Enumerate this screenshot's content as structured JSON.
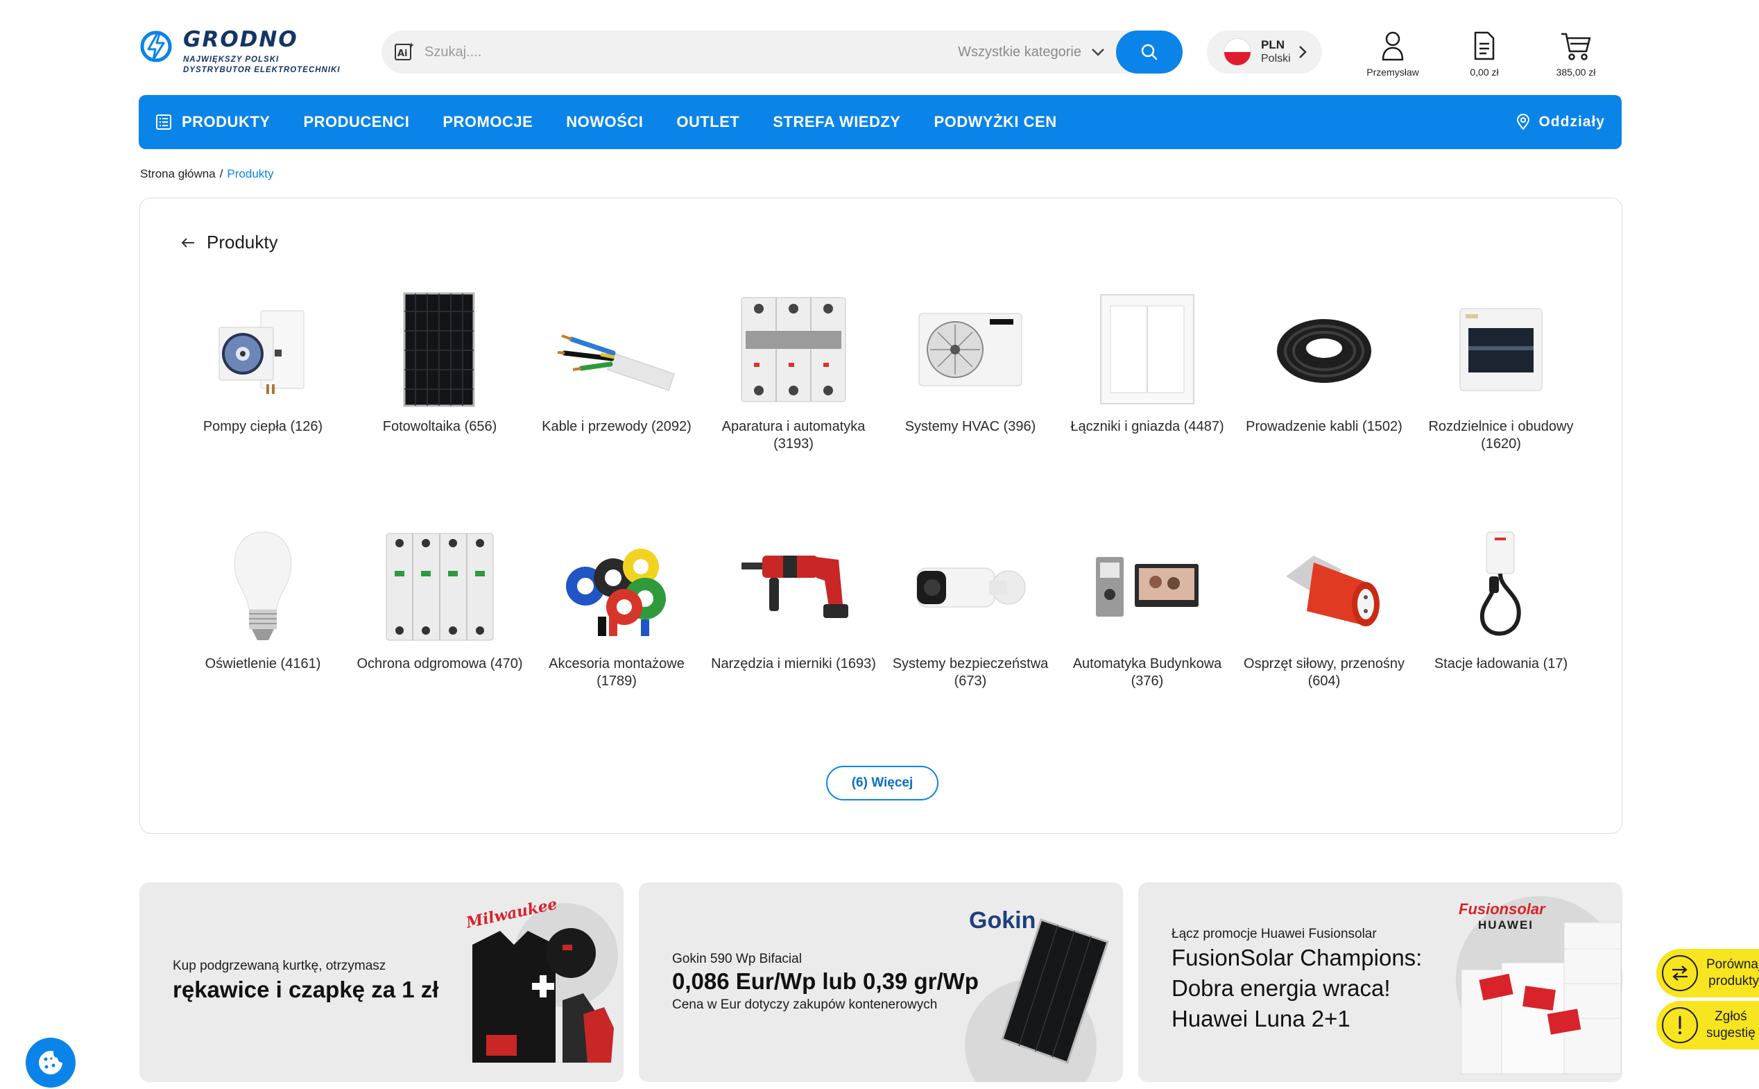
{
  "header": {
    "logo": {
      "title": "GRODNO",
      "subtitle_line1": "NAJWIĘKSZY POLSKI",
      "subtitle_line2": "DYSTRYBUTOR ELEKTROTECHNIKI"
    },
    "search": {
      "placeholder": "Szukaj....",
      "category": "Wszystkie kategorie"
    },
    "currency": {
      "code": "PLN",
      "language": "Polski"
    },
    "account": {
      "label": "Przemysław"
    },
    "documents": {
      "label": "0,00 zł"
    },
    "cart": {
      "label": "385,00 zł"
    }
  },
  "nav": {
    "items": [
      {
        "label": "PRODUKTY"
      },
      {
        "label": "PRODUCENCI"
      },
      {
        "label": "PROMOCJE"
      },
      {
        "label": "NOWOŚCI"
      },
      {
        "label": "OUTLET"
      },
      {
        "label": "STREFA WIEDZY"
      },
      {
        "label": "PODWYŻKI CEN"
      }
    ],
    "branches": "Oddziały"
  },
  "breadcrumb": {
    "home": "Strona główna",
    "separator": "/",
    "current": "Produkty"
  },
  "products": {
    "title": "Produkty",
    "categories": [
      {
        "label": "Pompy ciepła (126)",
        "icon": "heat-pump"
      },
      {
        "label": "Fotowoltaika (656)",
        "icon": "solar-panel"
      },
      {
        "label": "Kable i przewody (2092)",
        "icon": "cable"
      },
      {
        "label": "Aparatura i automatyka (3193)",
        "icon": "circuit-breaker"
      },
      {
        "label": "Systemy HVAC (396)",
        "icon": "ac-unit"
      },
      {
        "label": "Łączniki i gniazda (4487)",
        "icon": "wall-switch"
      },
      {
        "label": "Prowadzenie kabli (1502)",
        "icon": "conduit-coil"
      },
      {
        "label": "Rozdzielnice i obudowy (1620)",
        "icon": "distribution-box"
      },
      {
        "label": "Oświetlenie (4161)",
        "icon": "light-bulb"
      },
      {
        "label": "Ochrona odgromowa (470)",
        "icon": "surge-protector"
      },
      {
        "label": "Akcesoria montażowe (1789)",
        "icon": "insulating-tape"
      },
      {
        "label": "Narzędzia i mierniki (1693)",
        "icon": "hammer-drill"
      },
      {
        "label": "Systemy bezpieczeństwa (673)",
        "icon": "cctv-camera"
      },
      {
        "label": "Automatyka Budynkowa (376)",
        "icon": "intercom"
      },
      {
        "label": "Osprzęt siłowy, przenośny (604)",
        "icon": "industrial-plug"
      },
      {
        "label": "Stacje ładowania (17)",
        "icon": "ev-charger"
      }
    ],
    "more_button": "(6) Więcej"
  },
  "promos": [
    {
      "small": "Kup podgrzewaną kurtkę, otrzymasz",
      "big": "rękawice i czapkę za 1 zł",
      "brand": "Milwaukee"
    },
    {
      "small": "Gokin 590 Wp Bifacial",
      "big": "0,086 Eur/Wp lub 0,39 gr/Wp",
      "note": "Cena w Eur dotyczy zakupów kontenerowych",
      "brand": "Gokin"
    },
    {
      "small": "Łącz promocje Huawei Fusionsolar",
      "big_line1": "FusionSolar Champions:",
      "big_line2": "Dobra energia wraca!",
      "big_line3": "Huawei Luna 2+1",
      "brand": "Fusionsolar",
      "brand2": "HUAWEI"
    }
  ],
  "floating": {
    "compare": {
      "line1": "Porównaj",
      "line2": "produkty"
    },
    "report": {
      "line1": "Zgłoś",
      "line2": "sugestię"
    }
  },
  "colors": {
    "primary": "#0a84e8",
    "logo": "#143564",
    "side_buttons": "#f7e51f"
  }
}
